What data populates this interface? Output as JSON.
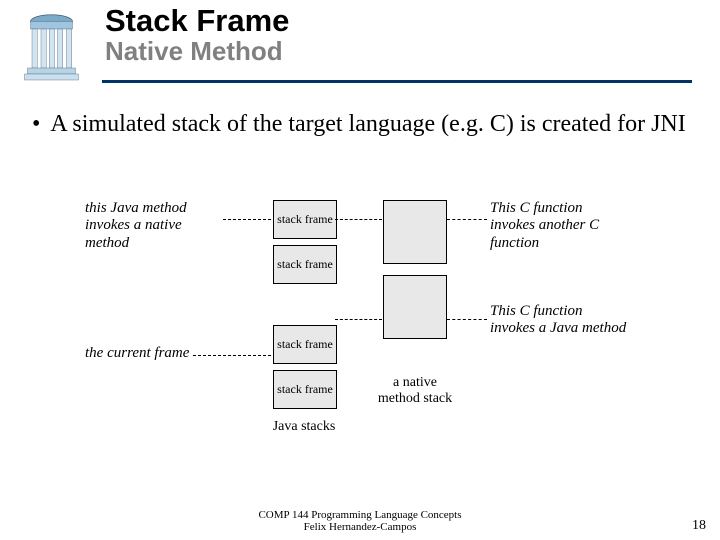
{
  "header": {
    "title": "Stack Frame",
    "subtitle": "Native Method"
  },
  "bullet": {
    "text": "A simulated stack of the target language (e.g. C) is created for JNI"
  },
  "diagram": {
    "note_top_left": "this Java method invokes a native method",
    "note_bottom_left": "the current frame",
    "note_top_right": "This C function invokes another C function",
    "note_bottom_right": "This C function invokes a Java method",
    "cell_label": "stack frame",
    "java_col_label": "Java stacks",
    "native_col_label": "a native method stack"
  },
  "footer": {
    "line1": "COMP 144 Programming Language Concepts",
    "line2": "Felix Hernandez-Campos"
  },
  "page_number": "18"
}
